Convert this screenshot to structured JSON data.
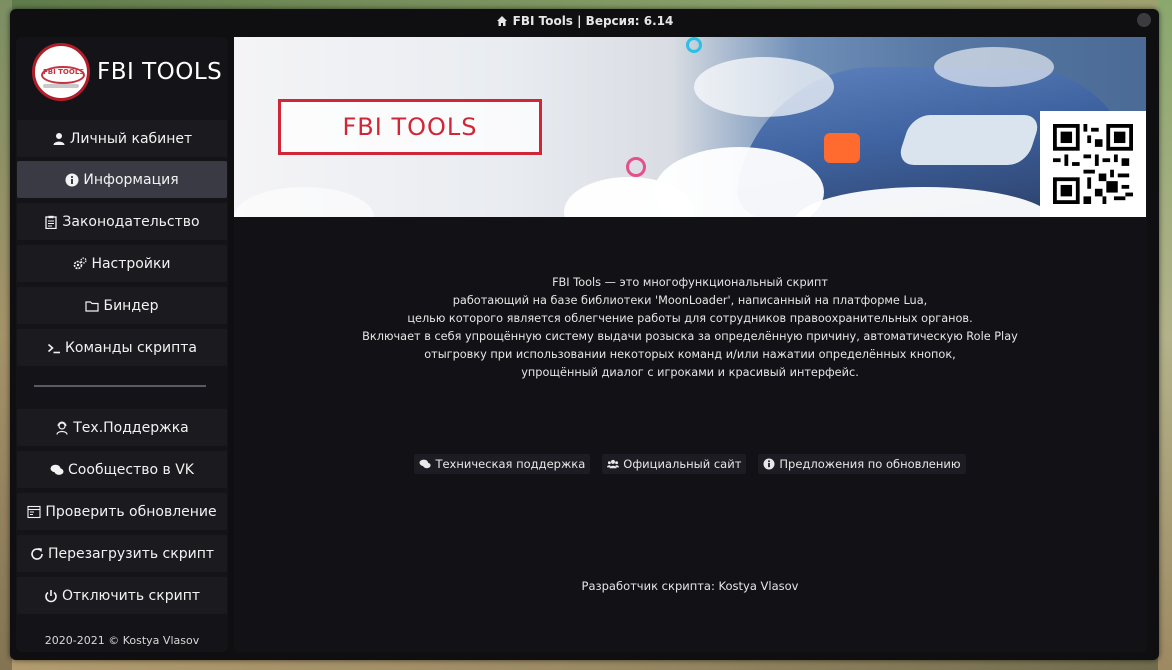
{
  "window": {
    "title": "FBI Tools | Версия: 6.14"
  },
  "sidebar": {
    "logo_text": "FBI TOOLS",
    "logo_badge": "FBI TOOLS",
    "items": [
      {
        "label": "Личный кабинет",
        "icon": "user-icon"
      },
      {
        "label": "Информация",
        "icon": "info-icon",
        "active": true
      },
      {
        "label": "Законодательство",
        "icon": "clipboard-icon"
      },
      {
        "label": "Настройки",
        "icon": "gears-icon"
      },
      {
        "label": "Биндер",
        "icon": "folder-icon"
      },
      {
        "label": "Команды скрипта",
        "icon": "terminal-icon"
      },
      {
        "label": "Тех.Поддержка",
        "icon": "support-agent-icon"
      },
      {
        "label": "Сообщество в VK",
        "icon": "chat-icon"
      },
      {
        "label": "Проверить обновление",
        "icon": "window-icon"
      },
      {
        "label": "Перезагрузить скрипт",
        "icon": "reload-icon"
      },
      {
        "label": "Отключить скрипт",
        "icon": "power-icon"
      }
    ],
    "copyright": "2020-2021 © Kostya Vlasov"
  },
  "main": {
    "banner_logo": "FBI TOOLS",
    "description": [
      "FBI Tools — это многофункциональный скрипт",
      "работающий на базе библиотеки 'MoonLoader', написанный на платформе Lua,",
      "целью которого является облегчение работы для сотрудников правоохранительных органов.",
      "Включает в себя упрощённую систему выдачи розыска за определённую причину, автоматическую Role Play",
      "отыгровку при использовании некоторых команд и/или нажатии определённых кнопок,",
      "упрощённый диалог с игроками и красивый интерфейс."
    ],
    "links": [
      {
        "label": "Техническая поддержка",
        "icon": "comments-icon"
      },
      {
        "label": "Официальный сайт",
        "icon": "users-icon"
      },
      {
        "label": "Предложения по обновлению",
        "icon": "info-icon"
      }
    ],
    "developer": "Разработчик скрипта: Kostya Vlasov"
  },
  "colors": {
    "window_bg": "#0f0f12",
    "sidebar_bg": "#141418",
    "menu_item_bg": "#1a1a1f",
    "menu_active_bg": "#3a3a44",
    "brand_red": "#d12638"
  }
}
